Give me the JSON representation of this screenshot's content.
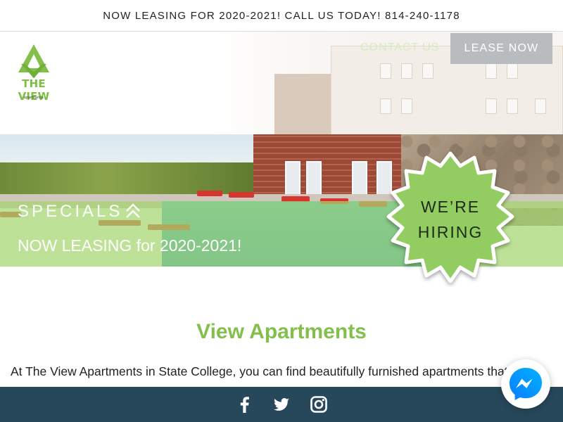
{
  "announcement": {
    "text": "NOW LEASING FOR 2020-2021! CALL US TODAY! 814-240-1178"
  },
  "header": {
    "logo_text": "THE VIEW",
    "logo_subtext": "apartments",
    "nav": {
      "contact_label": "CONTACT US",
      "lease_label": "LEASE NOW"
    }
  },
  "hero": {
    "specials_label": "SPECIALS",
    "leasing_text": "NOW LEASING for 2020-2021!",
    "badge_line1": "WE’RE",
    "badge_line2": "HIRING"
  },
  "main": {
    "title": "View Apartments",
    "intro": "At The View Apartments in State College, you can find beautifully furnished apartments that"
  },
  "footer": {
    "social_icons": [
      "facebook-icon",
      "twitter-icon",
      "instagram-icon"
    ]
  },
  "colors": {
    "brand_green": "#82c04b",
    "footer_navy": "#27485a",
    "lease_button_gray": "#b8bcbf",
    "badge_green": "#93cd62"
  }
}
